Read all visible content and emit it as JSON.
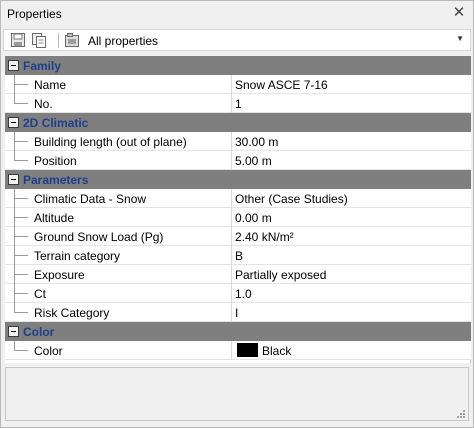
{
  "window": {
    "title": "Properties",
    "close_glyph": "✕"
  },
  "toolbar": {
    "icons": [
      "save-icon",
      "copy-properties-icon",
      "property-filter-icon"
    ],
    "filter_label": "All properties",
    "dropdown_glyph": "▼"
  },
  "grid": {
    "family": {
      "label": "Family",
      "name_label": "Name",
      "name_value": "Snow ASCE 7-16",
      "no_label": "No.",
      "no_value": "1"
    },
    "climatic2d": {
      "label": "2D Climatic",
      "building_length_label": "Building length (out of plane)",
      "building_length_value": "30.00 m",
      "position_label": "Position",
      "position_value": "5.00 m"
    },
    "parameters": {
      "label": "Parameters",
      "climatic_data_label": "Climatic Data - Snow",
      "climatic_data_value": "Other (Case Studies)",
      "altitude_label": "Altitude",
      "altitude_value": "0.00 m",
      "ground_snow_label": "Ground Snow Load (Pg)",
      "ground_snow_value": "2.40 kN/m²",
      "terrain_label": "Terrain category",
      "terrain_value": "B",
      "exposure_label": "Exposure",
      "exposure_value": "Partially exposed",
      "ct_label": "Ct",
      "ct_value": "1.0",
      "risk_label": "Risk Category",
      "risk_value": "I"
    },
    "color": {
      "label": "Color",
      "color_label": "Color",
      "color_value": "Black",
      "swatch_color": "#000000"
    }
  },
  "colors": {
    "category_bg": "#7f7f7f",
    "category_text": "#1e3f8a"
  }
}
